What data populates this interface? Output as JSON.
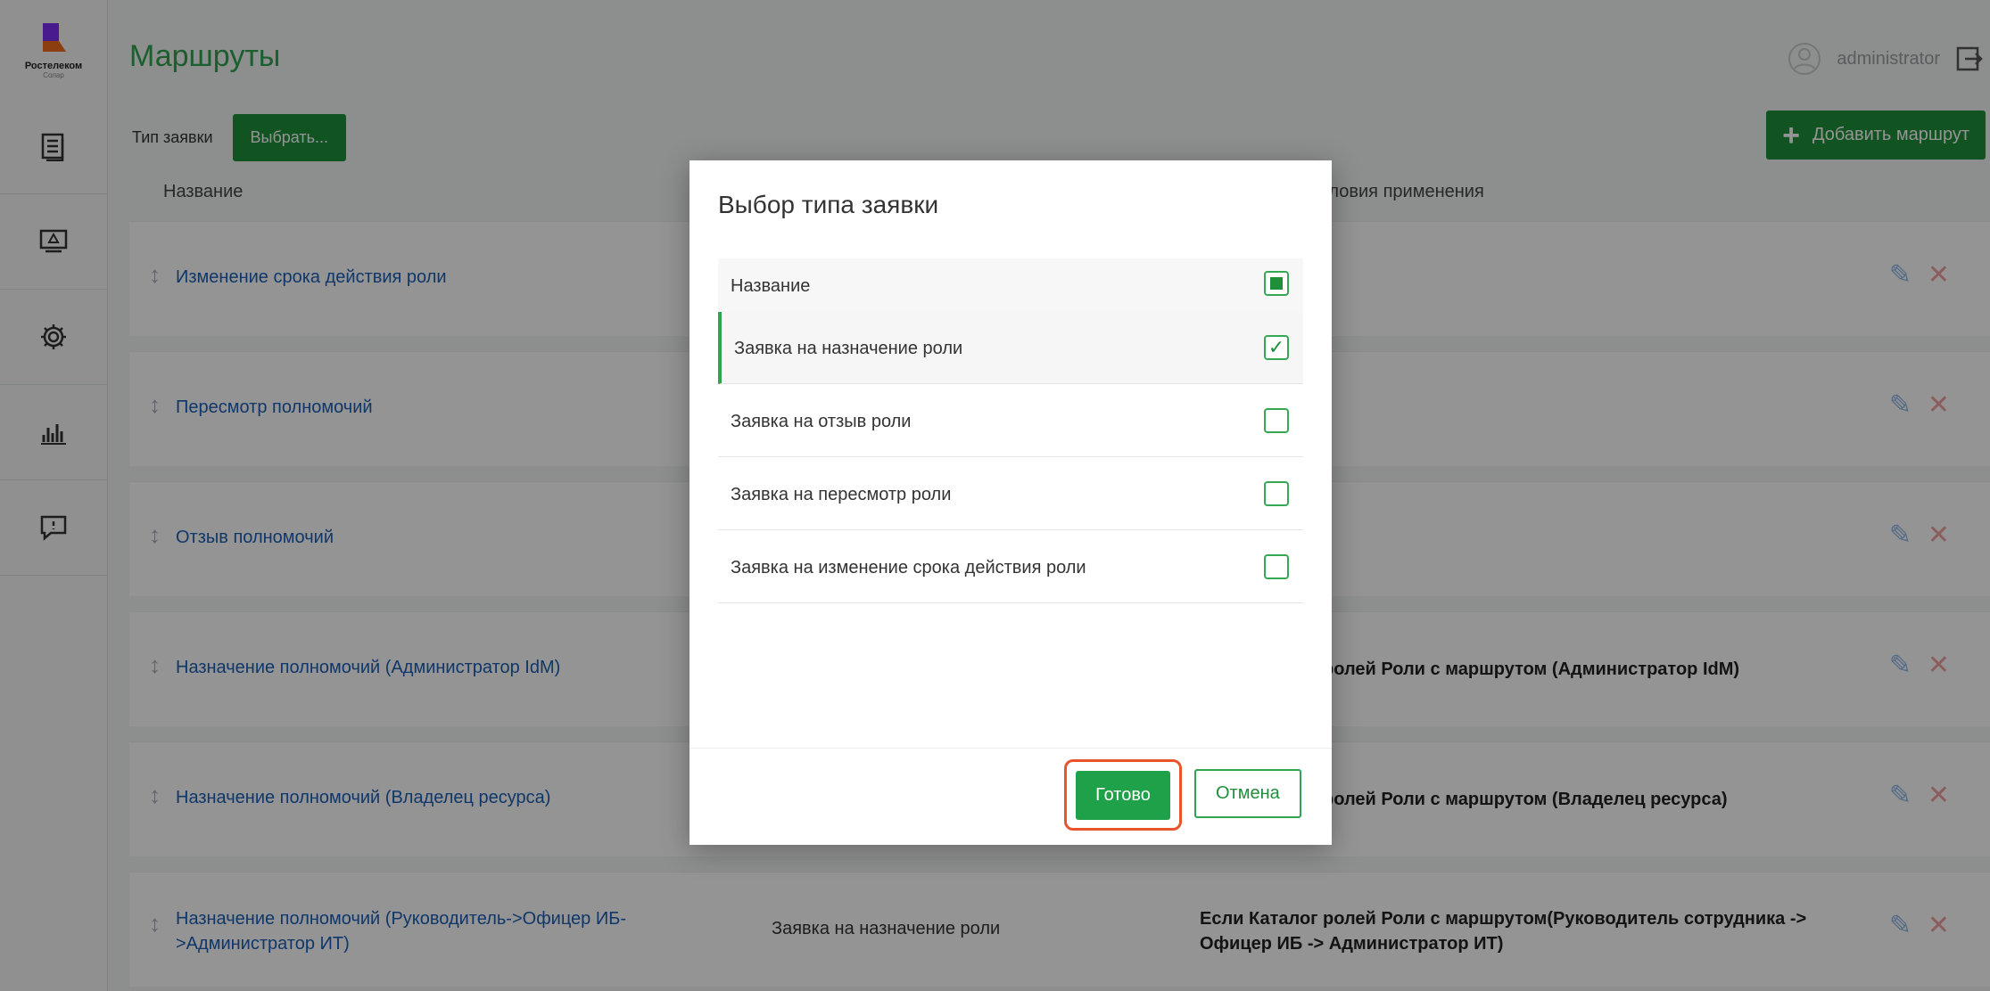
{
  "sidebar": {
    "logo_name": "Ростелеком",
    "logo_sub": "Солар",
    "items": [
      {
        "icon": "document-list-icon"
      },
      {
        "icon": "monitor-icon"
      },
      {
        "icon": "gear-icon"
      },
      {
        "icon": "bar-chart-icon"
      },
      {
        "icon": "feedback-icon"
      }
    ]
  },
  "header": {
    "title": "Маршруты",
    "username": "administrator"
  },
  "toolbar": {
    "filter_label": "Тип заявки",
    "select_button": "Выбрать...",
    "add_route_plus": "+",
    "add_route": "Добавить маршрут"
  },
  "table": {
    "columns": {
      "name": "Название",
      "condition": "Условия применения"
    },
    "rows": [
      {
        "name": "Изменение срока действия роли",
        "type": "",
        "condition": ""
      },
      {
        "name": "Пересмотр полномочий",
        "type": "",
        "condition": ""
      },
      {
        "name": "Отзыв полномочий",
        "type": "",
        "condition": ""
      },
      {
        "name": "Назначение полномочий (Администратор IdM)",
        "type": "",
        "condition": "Если Каталог ролей Роли с маршрутом (Администратор IdM)"
      },
      {
        "name": "Назначение полномочий (Владелец ресурса)",
        "type": "",
        "condition": "Если Каталог ролей Роли с маршрутом (Владелец ресурса)"
      },
      {
        "name": "Назначение полномочий (Руководитель->Офицер ИБ->Администратор ИТ)",
        "type": "Заявка на назначение роли",
        "condition": "Если Каталог ролей Роли с маршрутом(Руководитель сотрудника -> Офицер ИБ -> Администратор ИТ)"
      }
    ]
  },
  "modal": {
    "title": "Выбор типа заявки",
    "header_label": "Название",
    "options": [
      {
        "label": "Заявка на назначение роли",
        "checked": true
      },
      {
        "label": "Заявка на отзыв роли",
        "checked": false
      },
      {
        "label": "Заявка на пересмотр роли",
        "checked": false
      },
      {
        "label": "Заявка на изменение срока действия роли",
        "checked": false
      }
    ],
    "done": "Готово",
    "cancel": "Отмена"
  },
  "colors": {
    "accent": "#1f8f3c",
    "title": "#30a452",
    "link": "#1b5fb5",
    "highlight": "#e8552d"
  }
}
